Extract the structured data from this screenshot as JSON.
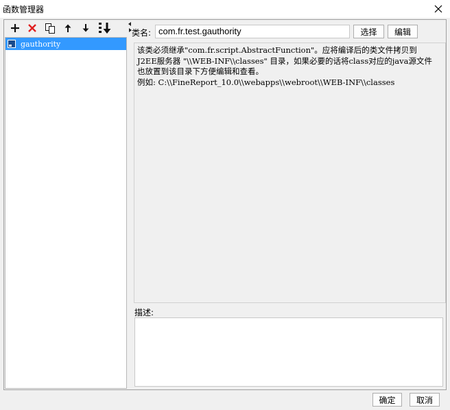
{
  "window": {
    "title": "函数管理器"
  },
  "toolbar": {
    "icons": [
      "plus-icon",
      "delete-icon",
      "copy-icon",
      "arrow-up-icon",
      "arrow-down-icon",
      "sort-down-icon"
    ],
    "colors": {
      "delete": "#e02020",
      "icon": "#111111"
    }
  },
  "tree": {
    "items": [
      {
        "label": "gauthority",
        "selected": true
      }
    ],
    "selection_color": "#3399ff"
  },
  "form": {
    "class_label": "类名:",
    "class_value": "com.fr.test.gauthority",
    "select_label": "选择",
    "edit_label": "编辑"
  },
  "info": {
    "lines": [
      "该类必须继承\"com.fr.script.AbstractFunction\"。应将编译后的类文件拷贝到",
      "J2EE服务器 \"\\\\WEB-INF\\\\classes\" 目录，如果必要的话将class对应的java源文件",
      "也放置到该目录下方便编辑和查看。",
      "例如: C:\\\\FineReport_10.0\\\\webapps\\\\webroot\\\\WEB-INF\\\\classes"
    ]
  },
  "description": {
    "label": "描述:",
    "value": ""
  },
  "footer": {
    "ok_label": "确定",
    "cancel_label": "取消"
  }
}
